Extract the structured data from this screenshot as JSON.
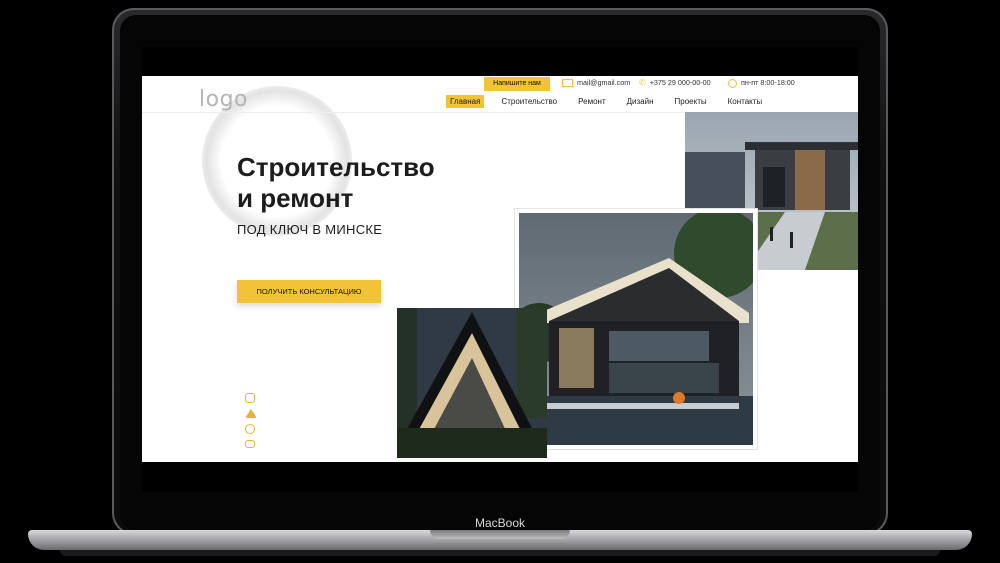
{
  "device": {
    "brand": "MacBook"
  },
  "header": {
    "logo": "logo",
    "write_button": "Напишите нам",
    "email": "mail@gmail.com",
    "phone": "+375 29 000-00-00",
    "hours": "пн-пт 8:00-18:00",
    "nav": [
      {
        "label": "Главная",
        "active": true
      },
      {
        "label": "Строительство",
        "active": false
      },
      {
        "label": "Ремонт",
        "active": false
      },
      {
        "label": "Дизайн",
        "active": false
      },
      {
        "label": "Проекты",
        "active": false
      },
      {
        "label": "Контакты",
        "active": false
      }
    ]
  },
  "hero": {
    "title_line1": "Строительство",
    "title_line2": "и ремонт",
    "subtitle": "ПОД КЛЮЧ В МИНСКЕ",
    "cta": "ПОЛУЧИТЬ КОНСУЛЬТАЦИЮ"
  },
  "socials": [
    "instagram-icon",
    "telegram-icon",
    "viber-icon",
    "youtube-icon"
  ],
  "colors": {
    "accent": "#f2c237",
    "text": "#1c1c1c",
    "logo": "#b5b5b5"
  }
}
